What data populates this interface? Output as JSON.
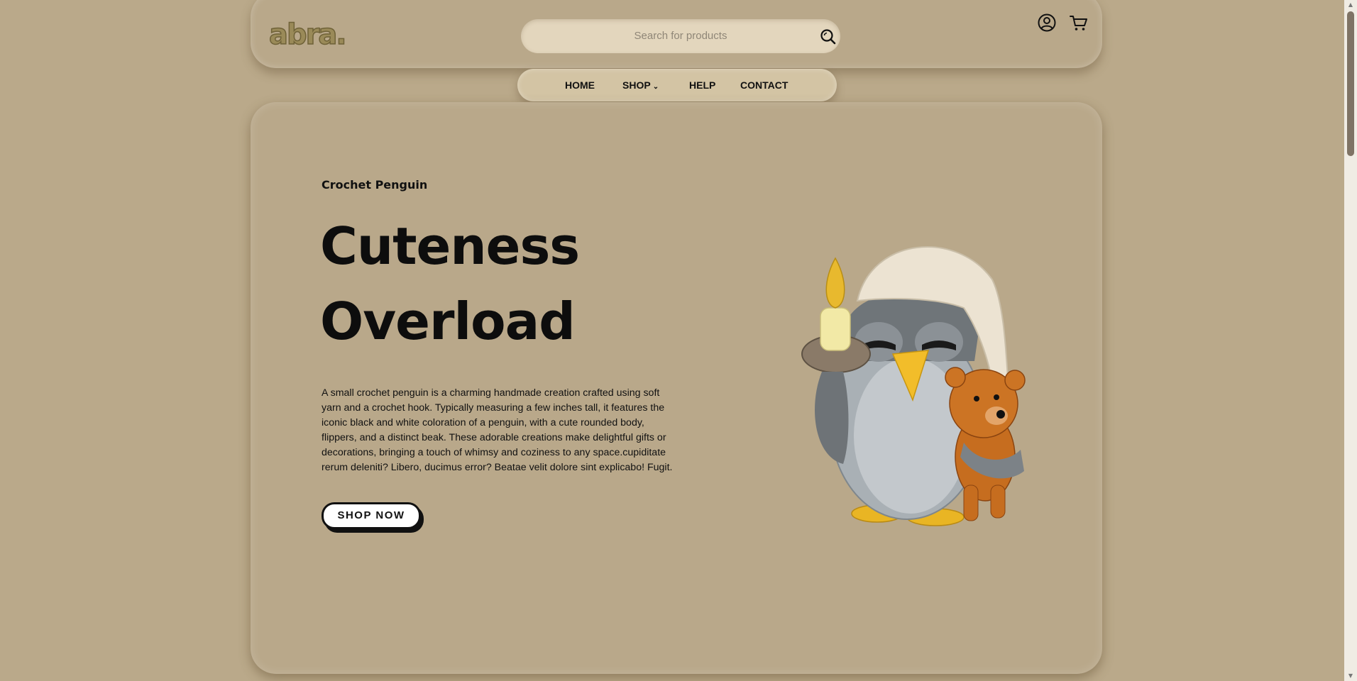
{
  "header": {
    "logo_text": "abra.",
    "search": {
      "placeholder": "Search for products"
    }
  },
  "nav": {
    "items": [
      {
        "label": "HOME"
      },
      {
        "label": "SHOP"
      },
      {
        "label": "HELP"
      },
      {
        "label": "CONTACT"
      }
    ]
  },
  "hero": {
    "eyebrow": "Crochet Penguin",
    "headline_line1": "Cuteness",
    "headline_line2": "Overload",
    "description": "A small crochet penguin is a charming handmade creation crafted using soft yarn and a crochet hook. Typically measuring a few inches tall, it features the iconic black and white coloration of a penguin, with a cute rounded body, flippers, and a distinct beak. These adorable creations make delightful gifts or decorations, bringing a touch of whimsy and coziness to any space.cupiditate rerum deleniti? Libero, ducimus error? Beatae velit dolore sint explicabo! Fugit.",
    "cta_label": "SHOP NOW"
  },
  "icons": {
    "search": "search-icon",
    "user": "user-icon",
    "cart": "cart-icon",
    "chevron": "chevron-down-icon"
  },
  "colors": {
    "background": "#baa98a",
    "search_field": "#e3d6bd",
    "nav_pill": "#d3c4a4",
    "logo_gold": "#8a7a4c"
  }
}
